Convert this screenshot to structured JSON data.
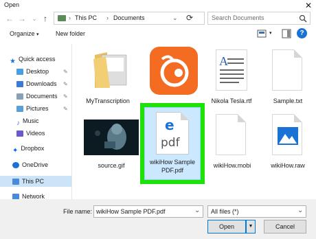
{
  "window": {
    "title": "Open",
    "close_glyph": "✕"
  },
  "address": {
    "back": "←",
    "forward": "→",
    "dropdown": "⌄",
    "up": "↑",
    "breadcrumb": [
      "This PC",
      "Documents"
    ],
    "separator": "›",
    "refresh": "⟳"
  },
  "search": {
    "placeholder": "Search Documents"
  },
  "toolbar": {
    "organize": "Organize",
    "organize_caret": "▾",
    "new_folder": "New folder",
    "view_caret": "▾",
    "help": "?"
  },
  "sidebar": {
    "items": [
      {
        "label": "Quick access",
        "icon": "star-icon",
        "color": "#1a73d4",
        "pinned": false
      },
      {
        "label": "Desktop",
        "icon": "desktop-folder-icon",
        "color": "#4a9de0",
        "pinned": true
      },
      {
        "label": "Downloads",
        "icon": "downloads-icon",
        "color": "#3a7bd5",
        "pinned": true
      },
      {
        "label": "Documents",
        "icon": "documents-icon",
        "color": "#8aa0b8",
        "pinned": true
      },
      {
        "label": "Pictures",
        "icon": "pictures-icon",
        "color": "#5aa0d8",
        "pinned": true
      },
      {
        "label": "Music",
        "icon": "music-icon",
        "color": "#4a7bd0",
        "pinned": false
      },
      {
        "label": "Videos",
        "icon": "videos-icon",
        "color": "#6a5ad0",
        "pinned": false
      },
      {
        "label": "Dropbox",
        "icon": "dropbox-icon",
        "color": "#0061fe",
        "pinned": false
      },
      {
        "label": "OneDrive",
        "icon": "onedrive-icon",
        "color": "#1a73d4",
        "pinned": false
      },
      {
        "label": "This PC",
        "icon": "this-pc-icon",
        "color": "#4a8ad8",
        "pinned": false,
        "selected": true
      },
      {
        "label": "Network",
        "icon": "network-icon",
        "color": "#4a8ad8",
        "pinned": false
      }
    ],
    "pin_glyph": "📌"
  },
  "files": [
    {
      "name": "MyTranscription",
      "icon": "folder-icon"
    },
    {
      "name": "",
      "icon": "uc-browser-icon"
    },
    {
      "name": "Nikola Tesla.rtf",
      "icon": "rtf-document-icon"
    },
    {
      "name": "Sample.txt",
      "icon": "text-document-icon"
    },
    {
      "name": "source.gif",
      "icon": "gif-thumbnail-icon"
    },
    {
      "name": "wikiHow Sample PDF.pdf",
      "line1": "wikiHow Sample",
      "line2": "PDF.pdf",
      "icon": "pdf-edge-icon",
      "selected": true,
      "badge_letter": "e",
      "badge_text": "pdf"
    },
    {
      "name": "wikiHow.mobi",
      "icon": "blank-document-icon"
    },
    {
      "name": "wikiHow.raw",
      "icon": "image-document-icon"
    }
  ],
  "colors": {
    "highlight_green": "#1ee10a",
    "accent_blue": "#1a73d4",
    "pdf_text": "#555555"
  },
  "bottom": {
    "file_name_label": "File name:",
    "file_name_value": "wikiHow Sample PDF.pdf",
    "file_type_value": "All files (*)",
    "open_label": "Open",
    "cancel_label": "Cancel",
    "dropdown_glyph": "⌄"
  }
}
